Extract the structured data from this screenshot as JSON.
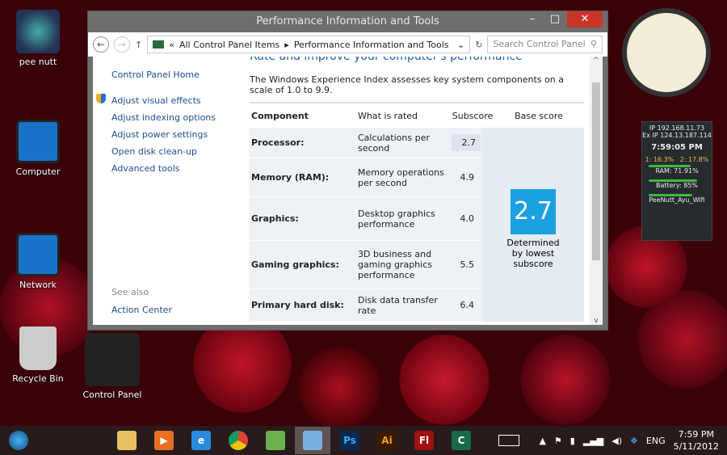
{
  "desktop": {
    "icons": [
      {
        "label": "pee nutt"
      },
      {
        "label": "Computer"
      },
      {
        "label": "Network"
      },
      {
        "label": "Recycle Bin"
      },
      {
        "label": "Control Panel"
      }
    ]
  },
  "window": {
    "title": "Performance Information and Tools",
    "breadcrumb": [
      "All Control Panel Items",
      "Performance Information and Tools"
    ],
    "search_placeholder": "Search Control Panel",
    "sidebar": {
      "home": "Control Panel Home",
      "links": [
        "Adjust visual effects",
        "Adjust indexing options",
        "Adjust power settings",
        "Open disk clean-up",
        "Advanced tools"
      ],
      "see_also": "See also",
      "see_also_links": [
        "Action Center"
      ]
    },
    "heading": "Rate and improve your computer's performance",
    "intro": "The Windows Experience Index assesses key system components on a scale of 1.0 to 9.9.",
    "table": {
      "headers": [
        "Component",
        "What is rated",
        "Subscore",
        "Base score"
      ],
      "rows": [
        {
          "component": "Processor:",
          "rated": "Calculations per second",
          "subscore": "2.7"
        },
        {
          "component": "Memory (RAM):",
          "rated": "Memory operations per second",
          "subscore": "4.9"
        },
        {
          "component": "Graphics:",
          "rated": "Desktop graphics performance",
          "subscore": "4.0"
        },
        {
          "component": "Gaming graphics:",
          "rated": "3D business and gaming graphics performance",
          "subscore": "5.5"
        },
        {
          "component": "Primary hard disk:",
          "rated": "Disk data transfer rate",
          "subscore": "6.4"
        }
      ],
      "base_score": "2.7",
      "base_caption": "Determined by lowest subscore"
    }
  },
  "gadget": {
    "ip": "IP 192.168.11.73",
    "ex_ip": "Ex IP 124.13.187.114",
    "time": "7:59:05 PM",
    "cpu1": "1: 16.3%",
    "cpu2": "2: 17.8%",
    "ram": "RAM: 71.91%",
    "ram_pct": 71.91,
    "battery": "Battery: 85%",
    "battery_pct": 85,
    "wifi": "PeeNutt_Ayu_Wifi"
  },
  "taskbar": {
    "apps": [
      "Explorer",
      "Media",
      "IE",
      "Chrome",
      "Evernote",
      "Control Panel",
      "Ps",
      "Ai",
      "Fl",
      "Camtasia"
    ],
    "lang": "ENG",
    "time": "7:59 PM",
    "date": "5/11/2012"
  }
}
